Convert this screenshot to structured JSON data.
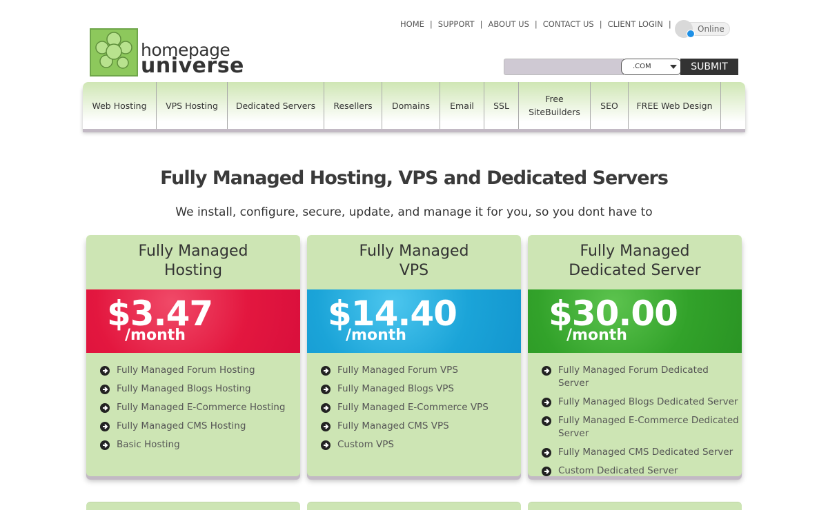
{
  "brand": {
    "line1": "homepage",
    "line2": "universe"
  },
  "topnav": [
    {
      "label": "HOME"
    },
    {
      "label": "SUPPORT"
    },
    {
      "label": "ABOUT US"
    },
    {
      "label": "CONTACT US"
    },
    {
      "label": "CLIENT LOGIN"
    }
  ],
  "status": {
    "label": "Online",
    "color": "#1e90e6"
  },
  "domain_search": {
    "value": "",
    "tld": ".COM",
    "submit_label": "SUBMIT"
  },
  "mainnav": [
    {
      "label": "Web Hosting"
    },
    {
      "label": "VPS Hosting"
    },
    {
      "label": "Dedicated Servers"
    },
    {
      "label": "Resellers"
    },
    {
      "label": "Domains"
    },
    {
      "label": "Email"
    },
    {
      "label": "SSL"
    },
    {
      "label": "Free\nSiteBuilders"
    },
    {
      "label": "SEO"
    },
    {
      "label": "FREE Web Design"
    }
  ],
  "headline": "Fully Managed Hosting, VPS and Dedicated Servers",
  "subline": "We install, configure, secure, update, and manage it for you, so you dont have to",
  "plans": [
    {
      "title": "Fully Managed\nHosting",
      "price": "$3.47",
      "period": "/month",
      "color": "#e3173f",
      "features": [
        "Fully Managed Forum Hosting",
        "Fully Managed Blogs Hosting",
        "Fully Managed E-Commerce Hosting",
        "Fully Managed CMS Hosting",
        "Basic Hosting"
      ]
    },
    {
      "title": "Fully Managed\nVPS",
      "price": "$14.40",
      "period": "/month",
      "color": "#1ba4d8",
      "features": [
        "Fully Managed Forum VPS",
        "Fully Managed Blogs VPS",
        "Fully Managed E-Commerce VPS",
        "Fully Managed CMS VPS",
        "Custom VPS"
      ]
    },
    {
      "title": "Fully Managed\nDedicated Server",
      "price": "$30.00",
      "period": "/month",
      "color": "#32a22a",
      "features": [
        "Fully Managed Forum Dedicated Server",
        "Fully Managed Blogs Dedicated Server",
        "Fully Managed E-Commerce Dedicated Server",
        "Fully Managed CMS Dedicated Server",
        "Custom Dedicated Server"
      ]
    }
  ]
}
